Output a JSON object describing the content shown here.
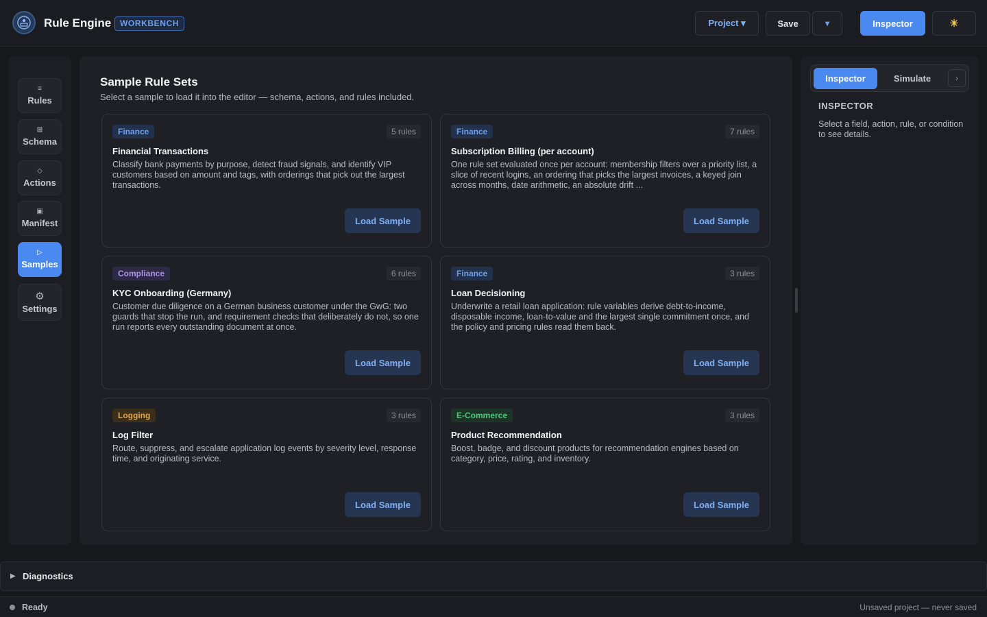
{
  "header": {
    "app_title": "Rule Engine",
    "badge": "WORKBENCH",
    "project_label": "Project ▾",
    "save_label": "Save",
    "dropdown_label": "▾",
    "inspector_label": "Inspector",
    "theme_icon": "☀"
  },
  "nav": {
    "items": [
      {
        "label": "Rules",
        "icon": "≡"
      },
      {
        "label": "Schema",
        "icon": "⊞"
      },
      {
        "label": "Actions",
        "icon": "◇"
      },
      {
        "label": "Manifest",
        "icon": "▣"
      },
      {
        "label": "Samples",
        "icon": "▷"
      },
      {
        "label": "Settings",
        "icon": "⚙"
      }
    ]
  },
  "main": {
    "title": "Sample Rule Sets",
    "subtitle": "Select a sample to load it into the editor — schema, actions, and rules included.",
    "cards": [
      {
        "tag": "Finance",
        "count": "5 rules",
        "title": "Financial Transactions",
        "desc": "Classify bank payments by purpose, detect fraud signals, and identify VIP customers based on amount and tags, with orderings that pick out the largest transactions.",
        "button": "Load Sample"
      },
      {
        "tag": "Finance",
        "count": "7 rules",
        "title": "Subscription Billing (per account)",
        "desc": "One rule set evaluated once per account: membership filters over a priority list, a slice of recent logins, an ordering that picks the largest invoices, a keyed join across months, date arithmetic, an absolute drift ...",
        "button": "Load Sample"
      },
      {
        "tag": "Compliance",
        "count": "6 rules",
        "title": "KYC Onboarding (Germany)",
        "desc": "Customer due diligence on a German business customer under the GwG: two guards that stop the run, and requirement checks that deliberately do not, so one run reports every outstanding document at once.",
        "button": "Load Sample"
      },
      {
        "tag": "Finance",
        "count": "3 rules",
        "title": "Loan Decisioning",
        "desc": "Underwrite a retail loan application: rule variables derive debt-to-income, disposable income, loan-to-value and the largest single commitment once, and the policy and pricing rules read them back.",
        "button": "Load Sample"
      },
      {
        "tag": "Logging",
        "count": "3 rules",
        "title": "Log Filter",
        "desc": "Route, suppress, and escalate application log events by severity level, response time, and originating service.",
        "button": "Load Sample"
      },
      {
        "tag": "E-Commerce",
        "count": "3 rules",
        "title": "Product Recommendation",
        "desc": "Boost, badge, and discount products for recommendation engines based on category, price, rating, and inventory.",
        "button": "Load Sample"
      }
    ]
  },
  "right": {
    "tab_inspector": "Inspector",
    "tab_simulate": "Simulate",
    "toggle": "›",
    "heading": "INSPECTOR",
    "text": "Select a field, action, rule, or condition to see details."
  },
  "diagnostics": {
    "label": "Diagnostics",
    "caret": "▶"
  },
  "status": {
    "text": "Ready",
    "right": "Unsaved project — never saved"
  }
}
